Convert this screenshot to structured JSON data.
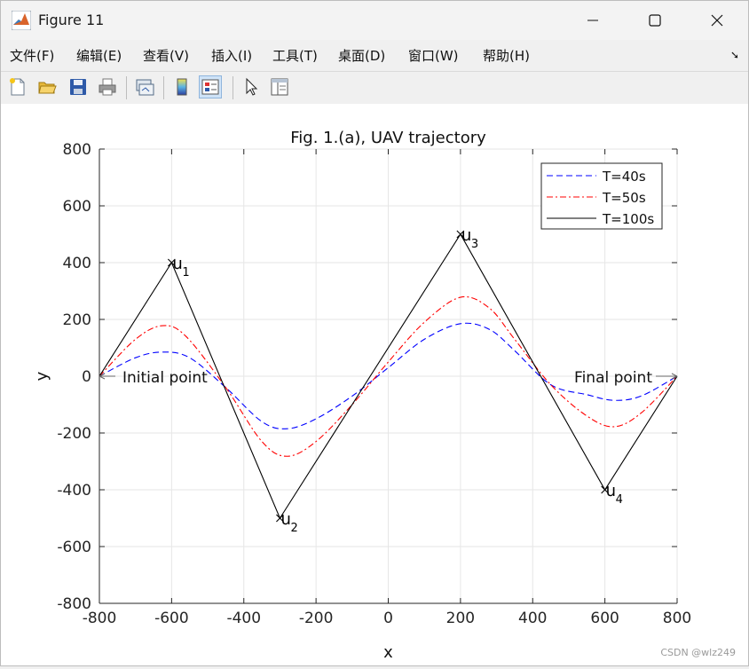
{
  "window": {
    "title": "Figure 11",
    "controls": {
      "minimize": "—",
      "maximize": "☐",
      "close": "✕"
    }
  },
  "menu": [
    "文件(F)",
    "编辑(E)",
    "查看(V)",
    "插入(I)",
    "工具(T)",
    "桌面(D)",
    "窗口(W)",
    "帮助(H)"
  ],
  "toolbar_icons": [
    "new-figure-icon",
    "open-file-icon",
    "save-icon",
    "print-icon",
    "link-plot-icon",
    "insert-colorbar-icon",
    "insert-legend-icon",
    "edit-plot-arrow-icon",
    "property-inspector-icon"
  ],
  "colors": {
    "T40": "#0000ff",
    "T50": "#ff0000",
    "T100": "#000000",
    "grid": "#e6e6e6"
  },
  "chart_data": {
    "type": "line",
    "title": "Fig. 1.(a), UAV trajectory",
    "xlabel": "x",
    "ylabel": "y",
    "xlim": [
      -800,
      800
    ],
    "ylim": [
      -800,
      800
    ],
    "xticks": [
      -800,
      -600,
      -400,
      -200,
      0,
      200,
      400,
      600,
      800
    ],
    "yticks": [
      -800,
      -600,
      -400,
      -200,
      0,
      200,
      400,
      600,
      800
    ],
    "grid": true,
    "legend_position": "top-right",
    "series": [
      {
        "name": "T=40s",
        "color": "#0000ff",
        "style": "dashed",
        "x": [
          -800,
          -700,
          -625,
          -550,
          -450,
          -350,
          -280,
          -200,
          -100,
          0,
          100,
          200,
          280,
          350,
          450,
          550,
          625,
          700,
          800
        ],
        "y": [
          0,
          65,
          85,
          65,
          -40,
          -160,
          -185,
          -150,
          -70,
          30,
          130,
          185,
          165,
          90,
          -30,
          -65,
          -85,
          -70,
          0
        ]
      },
      {
        "name": "T=50s",
        "color": "#ff0000",
        "style": "dashdot",
        "x": [
          -800,
          -700,
          -625,
          -560,
          -450,
          -350,
          -280,
          -200,
          -100,
          0,
          100,
          200,
          280,
          350,
          450,
          550,
          625,
          700,
          800
        ],
        "y": [
          0,
          130,
          178,
          140,
          -40,
          -230,
          -282,
          -230,
          -100,
          50,
          190,
          278,
          240,
          130,
          -30,
          -140,
          -178,
          -130,
          0
        ]
      },
      {
        "name": "T=100s",
        "color": "#000000",
        "style": "solid",
        "x": [
          -800,
          -600,
          -300,
          200,
          600,
          800
        ],
        "y": [
          0,
          400,
          -500,
          500,
          -400,
          0
        ]
      }
    ],
    "markers": [
      {
        "label": "u",
        "sub": "1",
        "x": -600,
        "y": 400
      },
      {
        "label": "u",
        "sub": "2",
        "x": -300,
        "y": -500
      },
      {
        "label": "u",
        "sub": "3",
        "x": 200,
        "y": 500
      },
      {
        "label": "u",
        "sub": "4",
        "x": 600,
        "y": -400
      }
    ],
    "annotations": [
      {
        "text": "Initial point",
        "x": -800,
        "y": 0,
        "side": "right"
      },
      {
        "text": "Final point",
        "x": 800,
        "y": 0,
        "side": "left"
      }
    ]
  },
  "watermark": "CSDN @wlz249"
}
